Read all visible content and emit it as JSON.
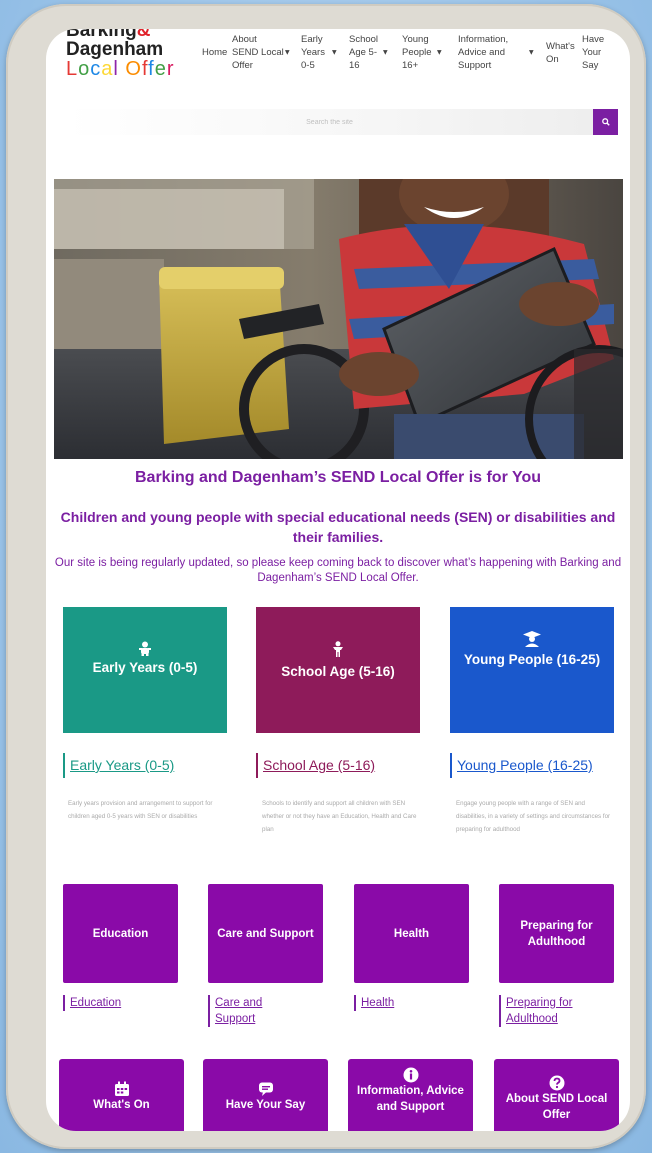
{
  "logo": {
    "line1": "Barking",
    "amp": "&",
    "line2": "Dagenham",
    "line3": "Local Offer",
    "line3_letters": [
      {
        "ch": "L",
        "color": "#e53935"
      },
      {
        "ch": "o",
        "color": "#43a047"
      },
      {
        "ch": "c",
        "color": "#1e88e5"
      },
      {
        "ch": "a",
        "color": "#fdd835"
      },
      {
        "ch": "l",
        "color": "#8e24aa"
      },
      {
        "ch": " ",
        "color": "#ffffff"
      },
      {
        "ch": "O",
        "color": "#fb8c00"
      },
      {
        "ch": "f",
        "color": "#e53935"
      },
      {
        "ch": "f",
        "color": "#1e88e5"
      },
      {
        "ch": "e",
        "color": "#43a047"
      },
      {
        "ch": "r",
        "color": "#d81b60"
      }
    ]
  },
  "nav": {
    "home": "Home",
    "about_l1": "About",
    "about_l2": "SEND Local",
    "about_l3": "Offer",
    "early_l1": "Early",
    "early_l2": "Years",
    "early_l3": "0-5",
    "school_l1": "School",
    "school_l2": "Age 5-",
    "school_l3": "16",
    "young_l1": "Young",
    "young_l2": "People",
    "young_l3": "16+",
    "info_l1": "Information,",
    "info_l2": "Advice and",
    "info_l3": "Support",
    "whats_l1": "What's",
    "whats_l2": "On",
    "have_l1": "Have",
    "have_l2": "Your",
    "have_l3": "Say"
  },
  "search": {
    "placeholder": "Search the site",
    "button_icon": "search-icon"
  },
  "main": {
    "heading": "Barking and Dagenham’s SEND Local Offer is for You",
    "subheading": "Children and young people with special educational needs (SEN) or disabilities and their families.",
    "update_text": "Our site is being regularly updated, so please keep coming back to discover what’s happening with Barking and Dagenham’s SEND Local Offer."
  },
  "age_groups": [
    {
      "card_label": "Early Years (0-5)",
      "link_label": "Early Years (0-5)",
      "color": "#1a9986",
      "icon": "baby-icon",
      "description": "Early years provision and arrangement to support for children aged 0-5 years with SEN or disabilities"
    },
    {
      "card_label": "School Age (5-16)",
      "link_label": "School Age (5-16)",
      "color": "#8e1b5a",
      "icon": "child-icon",
      "description": "Schools to identify and support all children with SEN whether or not they have an Education, Health and Care plan"
    },
    {
      "card_label": "Young People (16-25)",
      "link_label": "Young People (16-25)",
      "color": "#1a58cc",
      "icon": "graduate-icon",
      "description": "Engage young people with a range of SEN and disabilities, in a variety of settings and circumstances for preparing for adulthood"
    }
  ],
  "topics": [
    {
      "card_label": "Education",
      "link_label": "Education"
    },
    {
      "card_label": "Care and Support",
      "link_label": "Care and Support"
    },
    {
      "card_label": "Health",
      "link_label": "Health"
    },
    {
      "card_label": "Preparing for Adulthood",
      "link_label": "Preparing for Adulthood"
    }
  ],
  "bottom_cards": [
    {
      "label": "What's On",
      "icon": "calendar-icon"
    },
    {
      "label": "Have Your Say",
      "icon": "chat-icon"
    },
    {
      "label": "Information, Advice and Support",
      "icon": "info-icon"
    },
    {
      "label": "About SEND Local Offer",
      "icon": "question-icon"
    }
  ],
  "colors": {
    "purple": "#7b1fa2",
    "card_purple": "#8a0aa8"
  }
}
